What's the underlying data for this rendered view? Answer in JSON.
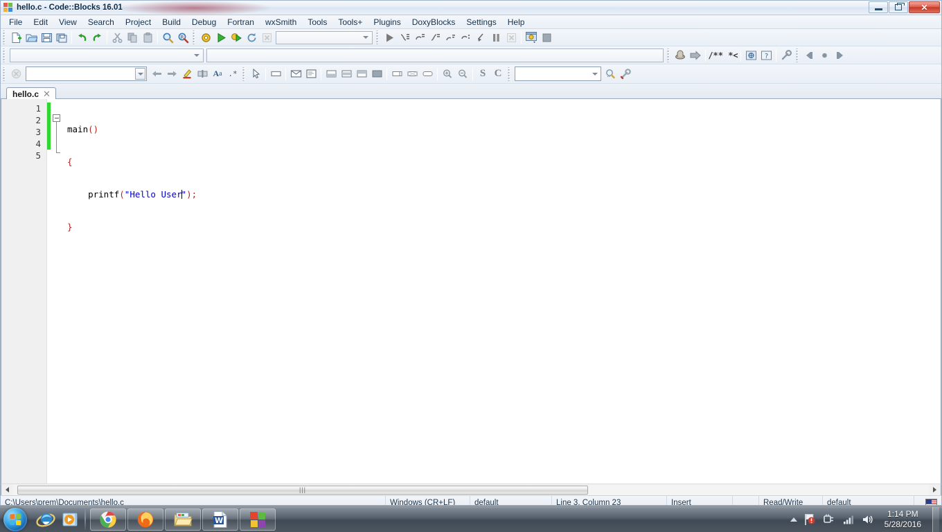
{
  "window": {
    "title": "hello.c - Code::Blocks 16.01",
    "icon": "codeblocks-icon",
    "buttons": {
      "minimize": "minimize-button",
      "restore": "restore-button",
      "close": "✕"
    }
  },
  "menubar": {
    "items": [
      {
        "label": "File",
        "name": "menu-file"
      },
      {
        "label": "Edit",
        "name": "menu-edit"
      },
      {
        "label": "View",
        "name": "menu-view"
      },
      {
        "label": "Search",
        "name": "menu-search"
      },
      {
        "label": "Project",
        "name": "menu-project"
      },
      {
        "label": "Build",
        "name": "menu-build"
      },
      {
        "label": "Debug",
        "name": "menu-debug"
      },
      {
        "label": "Fortran",
        "name": "menu-fortran"
      },
      {
        "label": "wxSmith",
        "name": "menu-wxsmith"
      },
      {
        "label": "Tools",
        "name": "menu-tools"
      },
      {
        "label": "Tools+",
        "name": "menu-tools-plus"
      },
      {
        "label": "Plugins",
        "name": "menu-plugins"
      },
      {
        "label": "DoxyBlocks",
        "name": "menu-doxyblocks"
      },
      {
        "label": "Settings",
        "name": "menu-settings"
      },
      {
        "label": "Help",
        "name": "menu-help"
      }
    ]
  },
  "toolbars": {
    "main": {
      "buttons": [
        {
          "name": "new-file-icon",
          "glyph": "📄",
          "title": "New file"
        },
        {
          "name": "open-file-icon",
          "glyph": "📂",
          "title": "Open"
        },
        {
          "name": "save-icon",
          "glyph": "💾",
          "title": "Save"
        },
        {
          "name": "save-all-icon",
          "glyph": "🗂",
          "title": "Save all"
        },
        {
          "name": "undo-icon",
          "glyph": "↶",
          "title": "Undo"
        },
        {
          "name": "redo-icon",
          "glyph": "↷",
          "title": "Redo"
        },
        {
          "name": "cut-icon",
          "glyph": "✂",
          "title": "Cut"
        },
        {
          "name": "copy-icon",
          "glyph": "❐",
          "title": "Copy"
        },
        {
          "name": "paste-icon",
          "glyph": "📋",
          "title": "Paste"
        },
        {
          "name": "find-icon",
          "glyph": "🔍",
          "title": "Find"
        },
        {
          "name": "replace-icon",
          "glyph": "🔎",
          "title": "Replace"
        }
      ]
    },
    "compiler": {
      "buttons": [
        {
          "name": "build-icon",
          "glyph": "⚙",
          "title": "Build"
        },
        {
          "name": "run-icon",
          "glyph": "▶",
          "title": "Run"
        },
        {
          "name": "build-and-run-icon",
          "glyph": "⚙▶",
          "title": "Build and run"
        },
        {
          "name": "rebuild-icon",
          "glyph": "⟳",
          "title": "Rebuild"
        },
        {
          "name": "abort-icon",
          "glyph": "✕",
          "title": "Abort"
        }
      ],
      "target_select": {
        "name": "build-target-select",
        "value": "",
        "placeholder": ""
      }
    },
    "debugger": {
      "buttons": [
        {
          "name": "debug-continue-icon",
          "glyph": "▶",
          "title": "Debug / Continue"
        },
        {
          "name": "step-into-icon",
          "glyph": "⤵",
          "title": "Step into"
        },
        {
          "name": "step-over-icon",
          "glyph": "↷",
          "title": "Next line"
        },
        {
          "name": "step-out-icon",
          "glyph": "⤴",
          "title": "Step out"
        },
        {
          "name": "next-instruction-icon",
          "glyph": "↪",
          "title": "Next instruction"
        },
        {
          "name": "step-into-instruction-icon",
          "glyph": "↬",
          "title": "Step into instruction"
        },
        {
          "name": "run-to-cursor-icon",
          "glyph": "↙",
          "title": "Run to cursor"
        },
        {
          "name": "break-debugger-icon",
          "glyph": "⏸",
          "title": "Break debugger"
        },
        {
          "name": "stop-debugger-icon",
          "glyph": "✕",
          "title": "Stop debugger"
        },
        {
          "name": "debugging-windows-icon",
          "glyph": "🗔",
          "title": "Debugging windows"
        },
        {
          "name": "various-info-icon",
          "glyph": "■",
          "title": "Various info"
        }
      ]
    },
    "doxyblocks": {
      "buttons": [
        {
          "name": "doxywizard-icon",
          "glyph": "⚙",
          "title": "Doxywizard"
        },
        {
          "name": "extract-docs-icon",
          "glyph": "➡",
          "title": "Extract documentation"
        },
        {
          "name": "block-comment-icon",
          "glyph": "/** *<",
          "title": "Block comment"
        },
        {
          "name": "run-html-icon",
          "glyph": "◎",
          "title": "Run HTML"
        },
        {
          "name": "run-chm-icon",
          "glyph": "?",
          "title": "Run CHM"
        },
        {
          "name": "doxyblocks-config-icon",
          "glyph": "🔧",
          "title": "Configuration"
        }
      ]
    },
    "browse": {
      "buttons": [
        {
          "name": "browse-back-icon",
          "glyph": "⇦",
          "title": "Back"
        },
        {
          "name": "browse-home-icon",
          "glyph": "●",
          "title": "Home"
        },
        {
          "name": "browse-forward-icon",
          "glyph": "⇨",
          "title": "Forward"
        }
      ]
    },
    "code_completion": {
      "scope_select": {
        "name": "scope-select",
        "value": "",
        "placeholder": ""
      },
      "function_select": {
        "name": "function-select",
        "value": "",
        "placeholder": ""
      }
    },
    "wxsmith": {
      "clear_icon": {
        "name": "clear-icon",
        "glyph": "⊗"
      },
      "search_combo": {
        "name": "wxsmith-search-input",
        "value": "",
        "placeholder": ""
      },
      "buttons": [
        {
          "name": "previous-icon",
          "glyph": "⇦",
          "title": "Previous"
        },
        {
          "name": "next-icon",
          "glyph": "⇨",
          "title": "Next"
        },
        {
          "name": "highlight-icon",
          "glyph": "✒",
          "title": "Highlight"
        },
        {
          "name": "whole-word-icon",
          "glyph": "⧉",
          "title": "Whole word"
        },
        {
          "name": "match-case-icon",
          "glyph": "Aa",
          "title": "Match case"
        },
        {
          "name": "regex-icon",
          "glyph": ".*",
          "title": "Regular expression"
        }
      ]
    },
    "wxsmith_widgets": {
      "buttons": [
        {
          "name": "pointer-icon",
          "glyph": "➤",
          "title": "Select"
        },
        {
          "name": "panel-icon",
          "glyph": "▭",
          "title": "Panel"
        },
        {
          "name": "dialog-icon",
          "glyph": "✉",
          "title": "Dialog"
        },
        {
          "name": "frame-icon",
          "glyph": "὜B",
          "title": "Frame"
        },
        {
          "name": "layout-top-icon",
          "glyph": "▤",
          "title": "Layout top"
        },
        {
          "name": "layout-middle-icon",
          "glyph": "▥",
          "title": "Layout middle"
        },
        {
          "name": "layout-bottom-icon",
          "glyph": "▦",
          "title": "Layout bottom"
        },
        {
          "name": "layout-fill-icon",
          "glyph": "■",
          "title": "Layout fill"
        },
        {
          "name": "sizer-h-icon",
          "glyph": "▭",
          "title": "Horizontal sizer"
        },
        {
          "name": "sizer-grid-icon",
          "glyph": "▨",
          "title": "Grid sizer"
        },
        {
          "name": "sizer-box-icon",
          "glyph": "▭",
          "title": "Box sizer"
        },
        {
          "name": "zoom-in-icon",
          "glyph": "⊕",
          "title": "Zoom in"
        },
        {
          "name": "zoom-out-icon",
          "glyph": "⊖",
          "title": "Zoom out"
        },
        {
          "name": "s-icon",
          "glyph": "S",
          "title": "S"
        },
        {
          "name": "c-icon",
          "glyph": "C",
          "title": "C"
        }
      ]
    },
    "symbols": {
      "symbol_select": {
        "name": "symbol-select",
        "value": "",
        "placeholder": ""
      },
      "buttons": [
        {
          "name": "symbol-search-icon",
          "glyph": "🔍",
          "title": "Search symbol"
        },
        {
          "name": "symbol-settings-icon",
          "glyph": "🔧",
          "title": "Settings"
        }
      ]
    }
  },
  "editor": {
    "tabs": [
      {
        "label": "hello.c",
        "close": "✕",
        "active": true
      }
    ],
    "line_numbers": [
      "1",
      "2",
      "3",
      "4",
      "5"
    ],
    "code_lines": [
      {
        "n": "1",
        "tokens": [
          {
            "t": "main",
            "k": "id"
          },
          {
            "t": "()",
            "k": "punc"
          }
        ]
      },
      {
        "n": "2",
        "tokens": [
          {
            "t": "{",
            "k": "punc"
          }
        ]
      },
      {
        "n": "3",
        "tokens": [
          {
            "t": "    printf",
            "k": "id"
          },
          {
            "t": "(",
            "k": "punc"
          },
          {
            "t": "\"Hello User\"",
            "k": "str"
          },
          {
            "t": ");",
            "k": "punc"
          }
        ]
      },
      {
        "n": "4",
        "tokens": [
          {
            "t": "}",
            "k": "punc"
          }
        ]
      },
      {
        "n": "5",
        "tokens": []
      }
    ],
    "plain_text": "main()\n{\n    printf(\"Hello User\");\n}\n",
    "colors": {
      "string": "#0000cd",
      "punctuation": "#b22222",
      "identifier": "#000000",
      "change_marker": "#2fd82f",
      "gutter_bg": "#f0f0f0"
    }
  },
  "scrollbar": {
    "left_arrow": "scroll-left-arrow",
    "right_arrow": "scroll-right-arrow",
    "grip": "|||"
  },
  "statusbar": {
    "file_path": "C:\\Users\\prem\\Documents\\hello.c",
    "line_ending": "Windows (CR+LF)",
    "encoding": "default",
    "cursor_position": "Line 3, Column 23",
    "insert_mode": "Insert",
    "blank": "",
    "access_mode": "Read/Write",
    "profile": "default",
    "keyboard_flag": "us-flag-icon"
  },
  "taskbar": {
    "start": {
      "name": "start-button",
      "label": "Start"
    },
    "quick_launch": [
      {
        "name": "internet-explorer-icon",
        "label": "Internet Explorer"
      },
      {
        "name": "windows-media-player-icon",
        "label": "Windows Media Player"
      }
    ],
    "tasks": [
      {
        "name": "taskbar-chrome",
        "label": "Google Chrome"
      },
      {
        "name": "taskbar-firefox",
        "label": "Mozilla Firefox"
      },
      {
        "name": "taskbar-file-explorer",
        "label": "File Explorer"
      },
      {
        "name": "taskbar-word",
        "label": "Microsoft Word"
      },
      {
        "name": "taskbar-codeblocks",
        "label": "Code::Blocks"
      }
    ],
    "tray": {
      "show_hidden": "show-hidden-icons-arrow",
      "icons": [
        {
          "name": "action-center-flag-icon",
          "label": "Action Center"
        },
        {
          "name": "safely-remove-hardware-icon",
          "label": "Safely Remove Hardware"
        },
        {
          "name": "network-signal-icon",
          "label": "Network"
        },
        {
          "name": "volume-speaker-icon",
          "label": "Volume"
        }
      ],
      "clock_time": "1:14 PM",
      "clock_date": "5/28/2016"
    },
    "show_desktop": "show-desktop-button"
  }
}
